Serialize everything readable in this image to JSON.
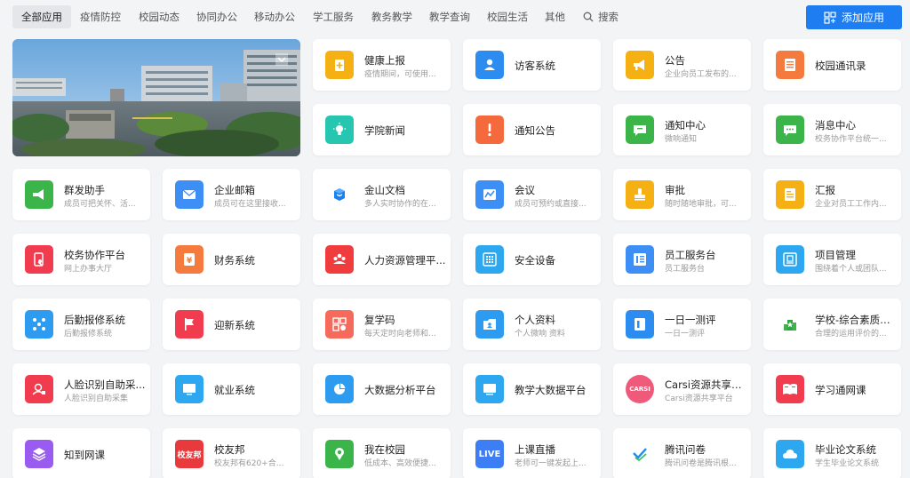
{
  "nav": {
    "tabs": [
      "全部应用",
      "疫情防控",
      "校园动态",
      "协同办公",
      "移动办公",
      "学工服务",
      "教务教学",
      "教学查询",
      "校园生活",
      "其他"
    ],
    "active_tab": "全部应用",
    "search_label": "搜索",
    "add_app_label": "添加应用"
  },
  "banner": {
    "alt": "campus"
  },
  "apps": [
    {
      "title": "健康上报",
      "subtitle": "疫情期间，可使用...",
      "color": "#f5b014",
      "icon": "plus-doc-icon"
    },
    {
      "title": "访客系统",
      "subtitle": "",
      "color": "#2d8cf0",
      "icon": "visitor-icon"
    },
    {
      "title": "公告",
      "subtitle": "企业向员工发布的...",
      "color": "#f5b014",
      "icon": "megaphone-icon"
    },
    {
      "title": "校园通讯录",
      "subtitle": "",
      "color": "#f57a3d",
      "icon": "contacts-icon"
    },
    {
      "title": "学院新闻",
      "subtitle": "",
      "color": "#26c6b0",
      "icon": "bulb-icon"
    },
    {
      "title": "通知公告",
      "subtitle": "",
      "color": "#f56a3d",
      "icon": "exclaim-icon"
    },
    {
      "title": "通知中心",
      "subtitle": "微响通知",
      "color": "#3bb54a",
      "icon": "notice-icon"
    },
    {
      "title": "消息中心",
      "subtitle": "校务协作平台统一...",
      "color": "#3bb54a",
      "icon": "message-icon"
    },
    {
      "title": "群发助手",
      "subtitle": "成员可把关怀、活...",
      "color": "#3bb54a",
      "icon": "broadcast-icon"
    },
    {
      "title": "企业邮箱",
      "subtitle": "成员可在这里接收...",
      "color": "#3d8ef5",
      "icon": "mail-icon"
    },
    {
      "title": "金山文档",
      "subtitle": "多人实时协作的在...",
      "color": "#ffffff",
      "icon": "kdocs-icon"
    },
    {
      "title": "会议",
      "subtitle": "成员可预约或直接...",
      "color": "#3d8ef5",
      "icon": "meeting-icon"
    },
    {
      "title": "审批",
      "subtitle": "随时随地审批，可...",
      "color": "#f5b014",
      "icon": "stamp-icon"
    },
    {
      "title": "汇报",
      "subtitle": "企业对员工工作内...",
      "color": "#f5b014",
      "icon": "report-icon"
    },
    {
      "title": "校务协作平台",
      "subtitle": "网上办事大厅",
      "color": "#f03c4e",
      "icon": "collab-icon"
    },
    {
      "title": "财务系统",
      "subtitle": "",
      "color": "#f57a3d",
      "icon": "yen-icon"
    },
    {
      "title": "人力资源管理平...",
      "subtitle": "",
      "color": "#f03c3c",
      "icon": "people-icon"
    },
    {
      "title": "安全设备",
      "subtitle": "",
      "color": "#2da8f0",
      "icon": "grid-icon"
    },
    {
      "title": "员工服务台",
      "subtitle": "员工服务台",
      "color": "#3d8ef5",
      "icon": "desk-icon"
    },
    {
      "title": "项目管理",
      "subtitle": "围绕着个人或团队...",
      "color": "#2da8f0",
      "icon": "project-icon"
    },
    {
      "title": "后勤报修系统",
      "subtitle": "后勤报修系统",
      "color": "#2d9cf0",
      "icon": "repair-icon"
    },
    {
      "title": "迎新系统",
      "subtitle": "",
      "color": "#f03c4e",
      "icon": "flag-icon"
    },
    {
      "title": "复学码",
      "subtitle": "每天定时向老师和...",
      "color": "#f56a5a",
      "icon": "qrcode-icon"
    },
    {
      "title": "个人资料",
      "subtitle": "个人微响 资料",
      "color": "#2d9cf0",
      "icon": "profile-icon"
    },
    {
      "title": "一日一测评",
      "subtitle": "一日一测评",
      "color": "#2d8cf0",
      "icon": "evaluate-icon"
    },
    {
      "title": "学校-综合素质评...",
      "subtitle": "合理的运用评价的...",
      "color": "#ffffff",
      "icon": "quality-icon"
    },
    {
      "title": "人脸识别自助采...",
      "subtitle": "人脸识别自助采集",
      "color": "#f03c4e",
      "icon": "face-icon"
    },
    {
      "title": "就业系统",
      "subtitle": "",
      "color": "#2da8f0",
      "icon": "monitor-icon"
    },
    {
      "title": "大数据分析平台",
      "subtitle": "",
      "color": "#2d9cf0",
      "icon": "pie-icon"
    },
    {
      "title": "教学大数据平台",
      "subtitle": "",
      "color": "#2da8f0",
      "icon": "screen-icon"
    },
    {
      "title": "Carsi资源共享平...",
      "subtitle": "Carsi资源共享平台",
      "color": "#f05a7a",
      "icon": "carsi-icon"
    },
    {
      "title": "学习通网课",
      "subtitle": "",
      "color": "#f03c4e",
      "icon": "book-icon"
    },
    {
      "title": "知到网课",
      "subtitle": "",
      "color": "#9a5cf0",
      "icon": "layers-icon"
    },
    {
      "title": "校友邦",
      "subtitle": "校友邦有620+合...",
      "color": "#e8393c",
      "icon": "alumni-icon"
    },
    {
      "title": "我在校园",
      "subtitle": "低成本、高效便捷...",
      "color": "#3bb54a",
      "icon": "campus-icon"
    },
    {
      "title": "上课直播",
      "subtitle": "老师可一键发起上...",
      "color": "#3d7ef5",
      "icon": "live-icon"
    },
    {
      "title": "腾讯问卷",
      "subtitle": "腾讯问卷是腾讯根...",
      "color": "#ffffff",
      "icon": "survey-icon"
    },
    {
      "title": "毕业论文系统",
      "subtitle": "学生毕业论文系统",
      "color": "#2da8f0",
      "icon": "cloud-icon"
    }
  ],
  "icon_text": {
    "alumni": "校友邦",
    "live": "LIVE",
    "carsi": "CARSI"
  }
}
